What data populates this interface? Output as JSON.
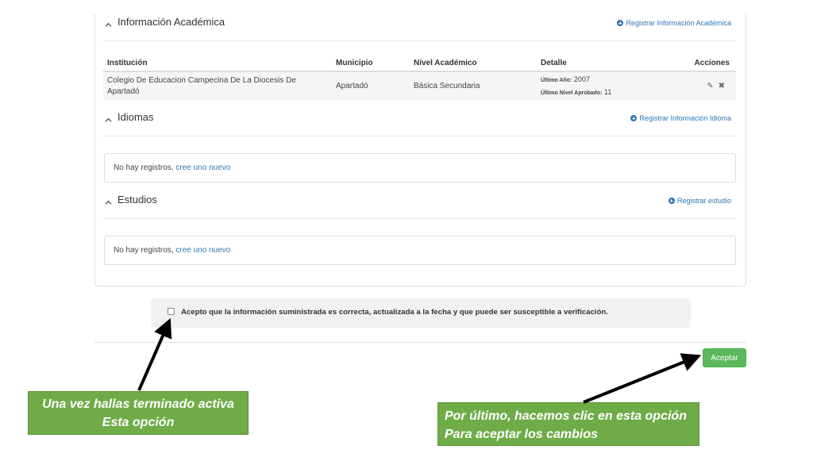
{
  "sections": {
    "academic": {
      "title": "Información Académica",
      "add_link": "Registrar Información Académica",
      "columns": [
        "Institución",
        "Municipio",
        "Nivel Académico",
        "Detalle",
        "Acciones"
      ],
      "rows": [
        {
          "institution_line1": "Colegio De Educacion Campecina De La Diocesis De",
          "institution_line2": "Apartadó",
          "municipality": "Apartadó",
          "level": "Básica Secundaria",
          "detail_year_label": "Último Año:",
          "detail_year_value": "2007",
          "detail_level_label": "Último Nivel Aprobado:",
          "detail_level_value": "11"
        }
      ]
    },
    "languages": {
      "title": "Idiomas",
      "add_link": "Registrar Información Idioma",
      "empty_text": "No hay registros,",
      "empty_link": "cree uno nuevo"
    },
    "studies": {
      "title": "Estudios",
      "add_link": "Registrar estudio",
      "empty_text": "No hay registros,",
      "empty_link": "cree uno nuevo"
    }
  },
  "acceptance": {
    "label": "Acepto que la información suministrada es correcta, actualizada a la fecha y que puede ser susceptible a verificación.",
    "checked": false
  },
  "buttons": {
    "accept": "Aceptar"
  },
  "callouts": {
    "left_line1": "Una vez hallas terminado activa",
    "left_line2": "Esta opción",
    "right_line1": "Por último, hacemos clic en esta opción",
    "right_line2": "Para aceptar los cambios"
  },
  "colors": {
    "link": "#2e75b6",
    "accept_button": "#5cb85c",
    "callout_bg": "#6fac47",
    "arrow": "#000000"
  },
  "icons": [
    "chevron-up-icon",
    "plus-circle-icon",
    "pencil-icon",
    "close-icon",
    "checkbox"
  ]
}
